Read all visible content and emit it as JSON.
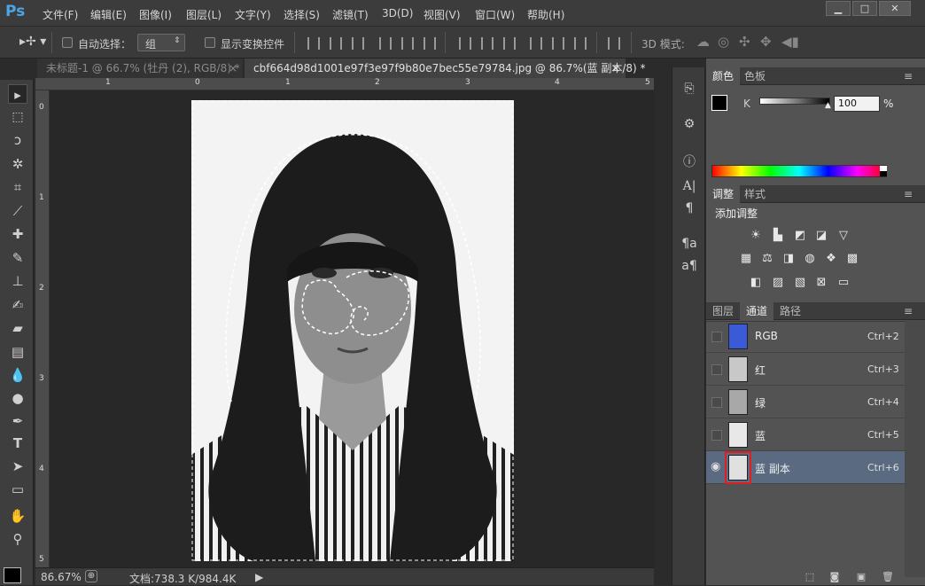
{
  "app": {
    "logo": "Ps"
  },
  "menu": [
    "文件(F)",
    "编辑(E)",
    "图像(I)",
    "图层(L)",
    "文字(Y)",
    "选择(S)",
    "滤镜(T)",
    "3D(D)",
    "视图(V)",
    "窗口(W)",
    "帮助(H)"
  ],
  "window_controls": [
    "▁",
    "□",
    "✕"
  ],
  "options": {
    "auto_select_label": "自动选择：",
    "auto_select_value": "组",
    "show_transform_label": "显示变换控件",
    "mode_3d_label": "3D 模式:"
  },
  "tabs": [
    {
      "label": "未标题-1 @ 66.7% (牡丹 (2), RGB/8) *",
      "active": false
    },
    {
      "label": "cbf664d98d1001e97f3e97f9b80e7bec55e79784.jpg @ 86.7%(蓝 副本/8) *",
      "active": true
    }
  ],
  "ruler": {
    "top": [
      "1",
      "0",
      "1",
      "2",
      "3",
      "4",
      "5"
    ],
    "left": [
      "0",
      "1",
      "2",
      "3",
      "4",
      "5"
    ]
  },
  "status": {
    "zoom": "86.67%",
    "doc": "文档:738.3 K/984.4K"
  },
  "color_panel": {
    "tabs": [
      "颜色",
      "色板"
    ],
    "channel": "K",
    "value": "100",
    "unit": "%"
  },
  "adjust_panel": {
    "tabs": [
      "调整",
      "样式"
    ],
    "title": "添加调整"
  },
  "channels_panel": {
    "tabs": [
      "图层",
      "通道",
      "路径"
    ],
    "rows": [
      {
        "name": "RGB",
        "shortcut": "Ctrl+2",
        "selected": false
      },
      {
        "name": "红",
        "shortcut": "Ctrl+3",
        "selected": false
      },
      {
        "name": "绿",
        "shortcut": "Ctrl+4",
        "selected": false
      },
      {
        "name": "蓝",
        "shortcut": "Ctrl+5",
        "selected": false
      },
      {
        "name": "蓝 副本",
        "shortcut": "Ctrl+6",
        "selected": true
      }
    ]
  },
  "colors": {
    "accent": "#4aa6e8",
    "selected_row": "#5a6a80",
    "highlight_box": "#e02020"
  }
}
